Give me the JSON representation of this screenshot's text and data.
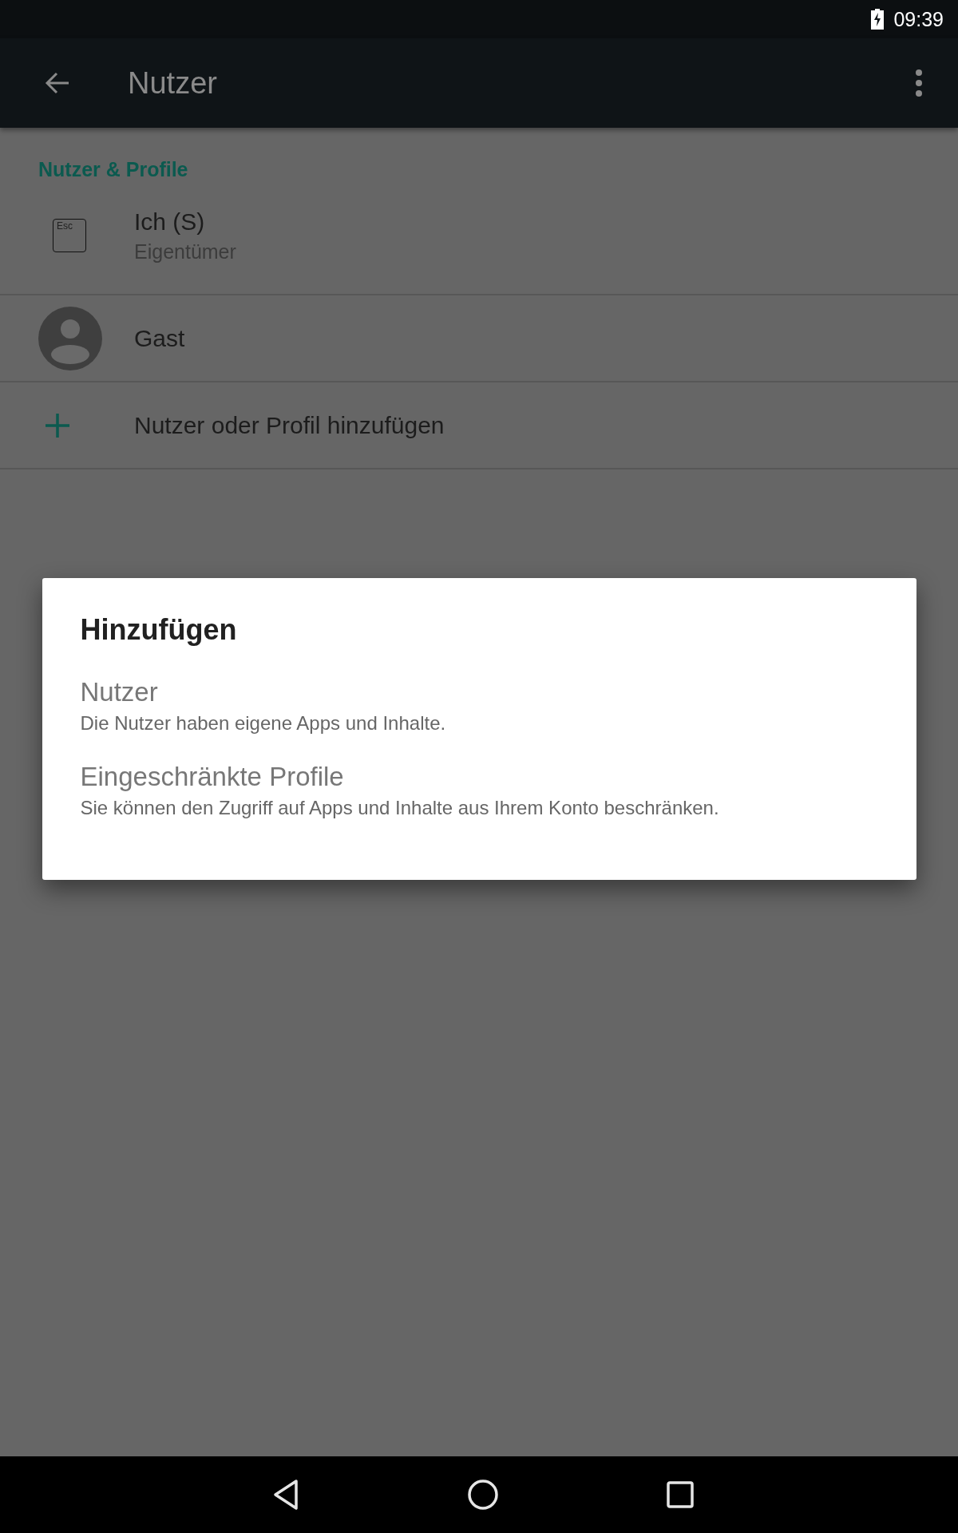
{
  "status_bar": {
    "time": "09:39"
  },
  "toolbar": {
    "title": "Nutzer"
  },
  "section": {
    "header": "Nutzer & Profile"
  },
  "rows": [
    {
      "kind": "owner",
      "key_label": "Esc",
      "title": "Ich (S)",
      "subtitle": "Eigentümer"
    },
    {
      "kind": "guest",
      "title": "Gast"
    },
    {
      "kind": "add",
      "title": "Nutzer oder Profil hinzufügen"
    }
  ],
  "dialog": {
    "title": "Hinzufügen",
    "items": [
      {
        "title": "Nutzer",
        "description": "Die Nutzer haben eigene Apps und Inhalte.",
        "disabled": true
      },
      {
        "title": "Eingeschränkte Profile",
        "description": "Sie können den Zugriff auf Apps und Inhalte aus Ihrem Konto beschränken.",
        "disabled": true
      }
    ]
  }
}
